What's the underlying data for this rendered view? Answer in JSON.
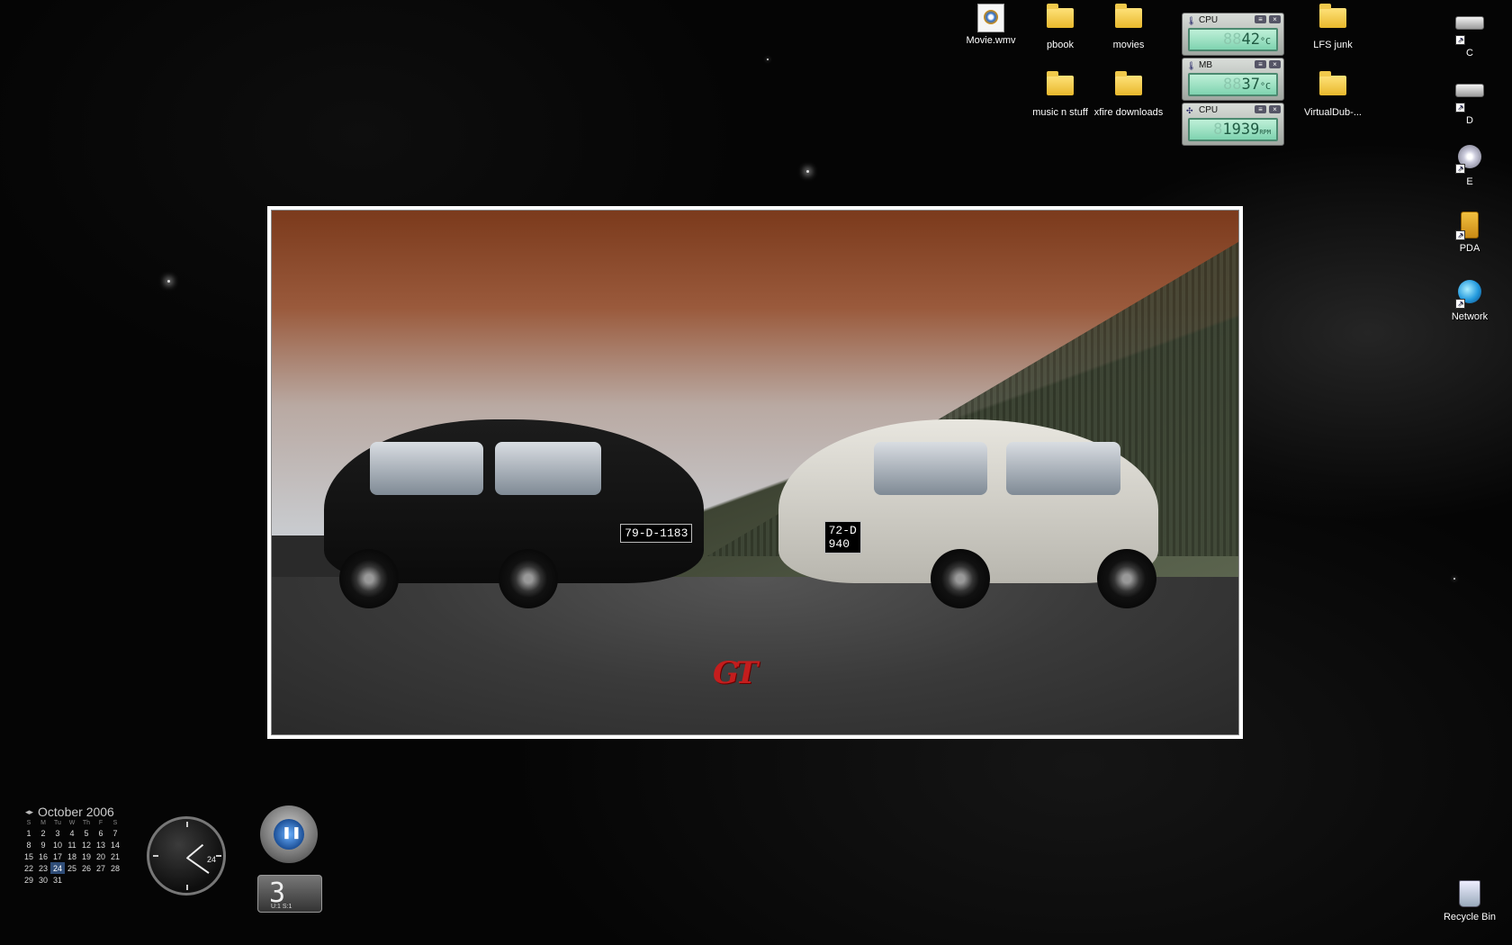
{
  "desktop_icons": {
    "movie": "Movie.wmv",
    "pbook": "pbook",
    "movies": "movies",
    "lfs": "LFS junk",
    "music": "music n stuff",
    "xfire": "xfire downloads",
    "virtualdub": "VirtualDub-...",
    "drive_c": "C",
    "drive_d": "D",
    "drive_e": "E",
    "pda": "PDA",
    "network": "Network",
    "recycle": "Recycle Bin"
  },
  "monitors": [
    {
      "label": "CPU",
      "value": "42",
      "unit": "°C",
      "ghost": "88"
    },
    {
      "label": "MB",
      "value": "37",
      "unit": "°C",
      "ghost": "88"
    },
    {
      "label": "CPU",
      "value": "1939",
      "unit": "RPM",
      "ghost": "8"
    }
  ],
  "wallpaper": {
    "plate_black": "79-D-1183",
    "plate_white_1": "72-D",
    "plate_white_2": "940",
    "logo": "GT"
  },
  "calendar": {
    "title": "October 2006",
    "dow": [
      "S",
      "M",
      "Tu",
      "W",
      "Th",
      "F",
      "S"
    ],
    "weeks": [
      [
        "1",
        "2",
        "3",
        "4",
        "5",
        "6",
        "7"
      ],
      [
        "8",
        "9",
        "10",
        "11",
        "12",
        "13",
        "14"
      ],
      [
        "15",
        "16",
        "17",
        "18",
        "19",
        "20",
        "21"
      ],
      [
        "22",
        "23",
        "24",
        "25",
        "26",
        "27",
        "28"
      ],
      [
        "29",
        "30",
        "31",
        "",
        "",
        "",
        ""
      ]
    ],
    "today": "24"
  },
  "clock": {
    "date": "24"
  },
  "counter": {
    "digits": "3",
    "ul": "U:1 S:1"
  }
}
